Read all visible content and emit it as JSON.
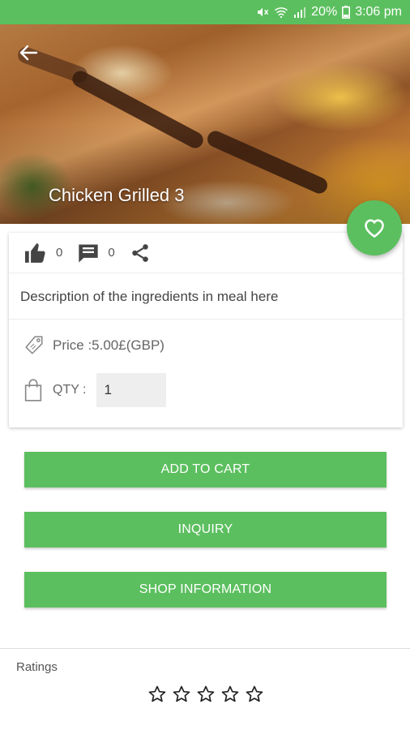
{
  "status_bar": {
    "battery": "20%",
    "time": "3:06 pm"
  },
  "product": {
    "title": "Chicken Grilled 3",
    "likes": "0",
    "comments": "0",
    "description": "Description of the ingredients in meal here",
    "price": "Price :5.00£(GBP)",
    "qty_label": "QTY :",
    "qty_value": "1"
  },
  "buttons": {
    "add_to_cart": "ADD TO CART",
    "inquiry": "INQUIRY",
    "shop_information": "SHOP INFORMATION"
  },
  "ratings": {
    "label": "Ratings",
    "value": 0,
    "max": 5
  },
  "colors": {
    "accent": "#5cbf5f"
  }
}
